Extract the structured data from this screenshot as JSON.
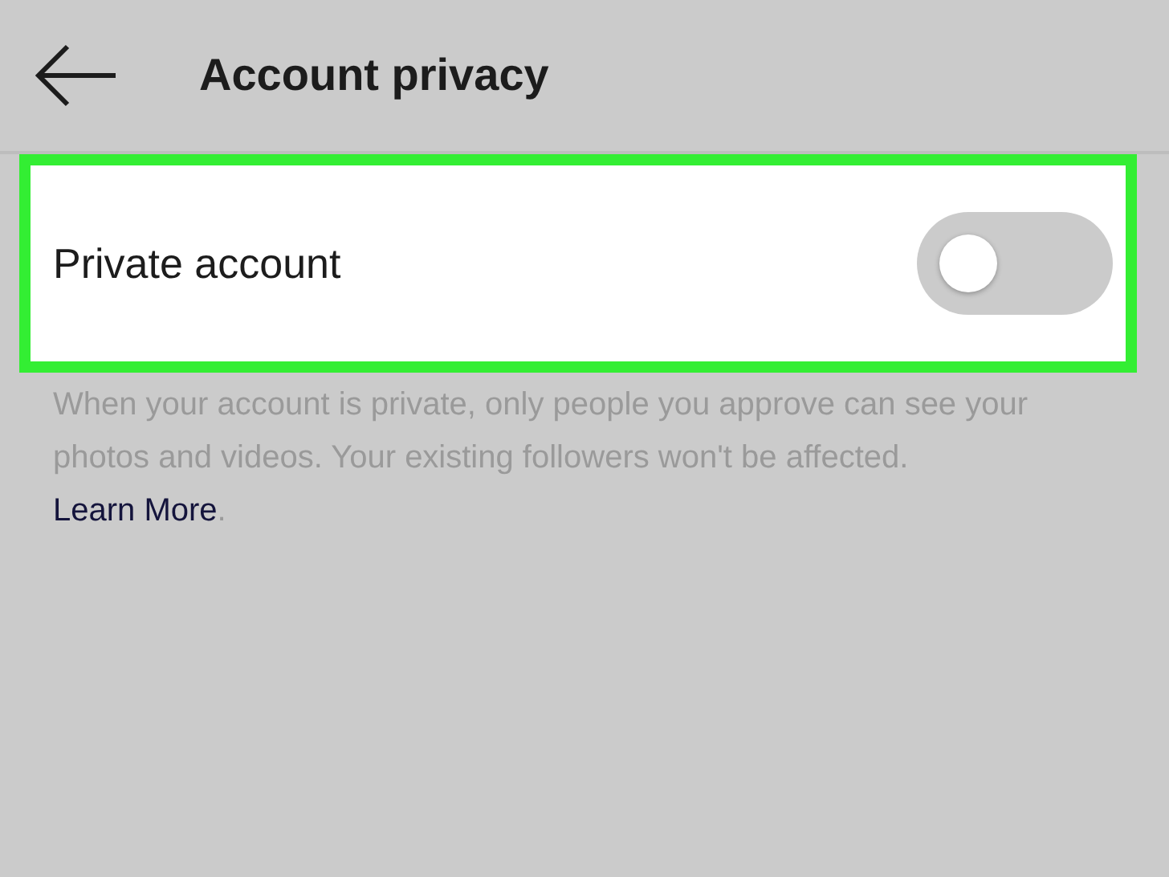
{
  "header": {
    "title": "Account privacy"
  },
  "setting": {
    "label": "Private account",
    "on": false,
    "highlighted": true
  },
  "description": {
    "text": "When your account is private, only people you approve can see your photos and videos. Your existing followers won't be affected.",
    "link": "Learn More",
    "suffix": "."
  }
}
